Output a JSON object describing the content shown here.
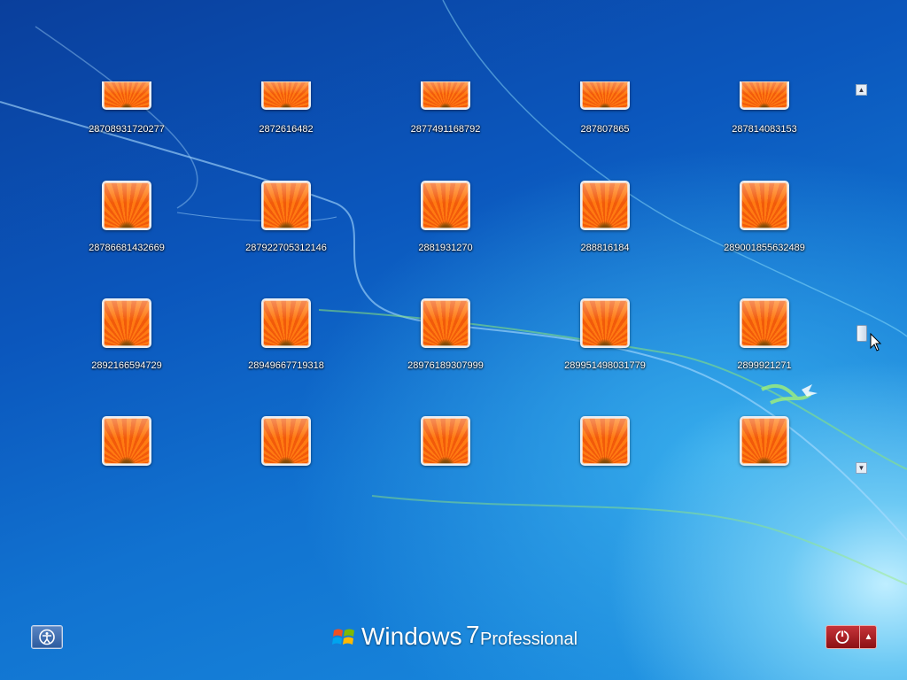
{
  "screen": "Windows 7 logon - user selection",
  "users": [
    {
      "name": "28708931720277"
    },
    {
      "name": "2872616482"
    },
    {
      "name": "2877491168792"
    },
    {
      "name": "287807865"
    },
    {
      "name": "287814083153"
    },
    {
      "name": "28786681432669"
    },
    {
      "name": "287922705312146"
    },
    {
      "name": "2881931270"
    },
    {
      "name": "288816184"
    },
    {
      "name": "289001855632489"
    },
    {
      "name": "2892166594729"
    },
    {
      "name": "28949667719318"
    },
    {
      "name": "28976189307999"
    },
    {
      "name": "289951498031779"
    },
    {
      "name": "2899921271"
    },
    {
      "name": ""
    },
    {
      "name": ""
    },
    {
      "name": ""
    },
    {
      "name": ""
    },
    {
      "name": ""
    }
  ],
  "scroll": {
    "up_icon": "scroll-up-arrow",
    "down_icon": "scroll-down-arrow"
  },
  "branding": {
    "windows": "Windows",
    "version": "7",
    "edition": "Professional"
  },
  "buttons": {
    "ease_of_access": "ease-of-access-icon",
    "power": "power-icon",
    "power_options": "▲"
  }
}
